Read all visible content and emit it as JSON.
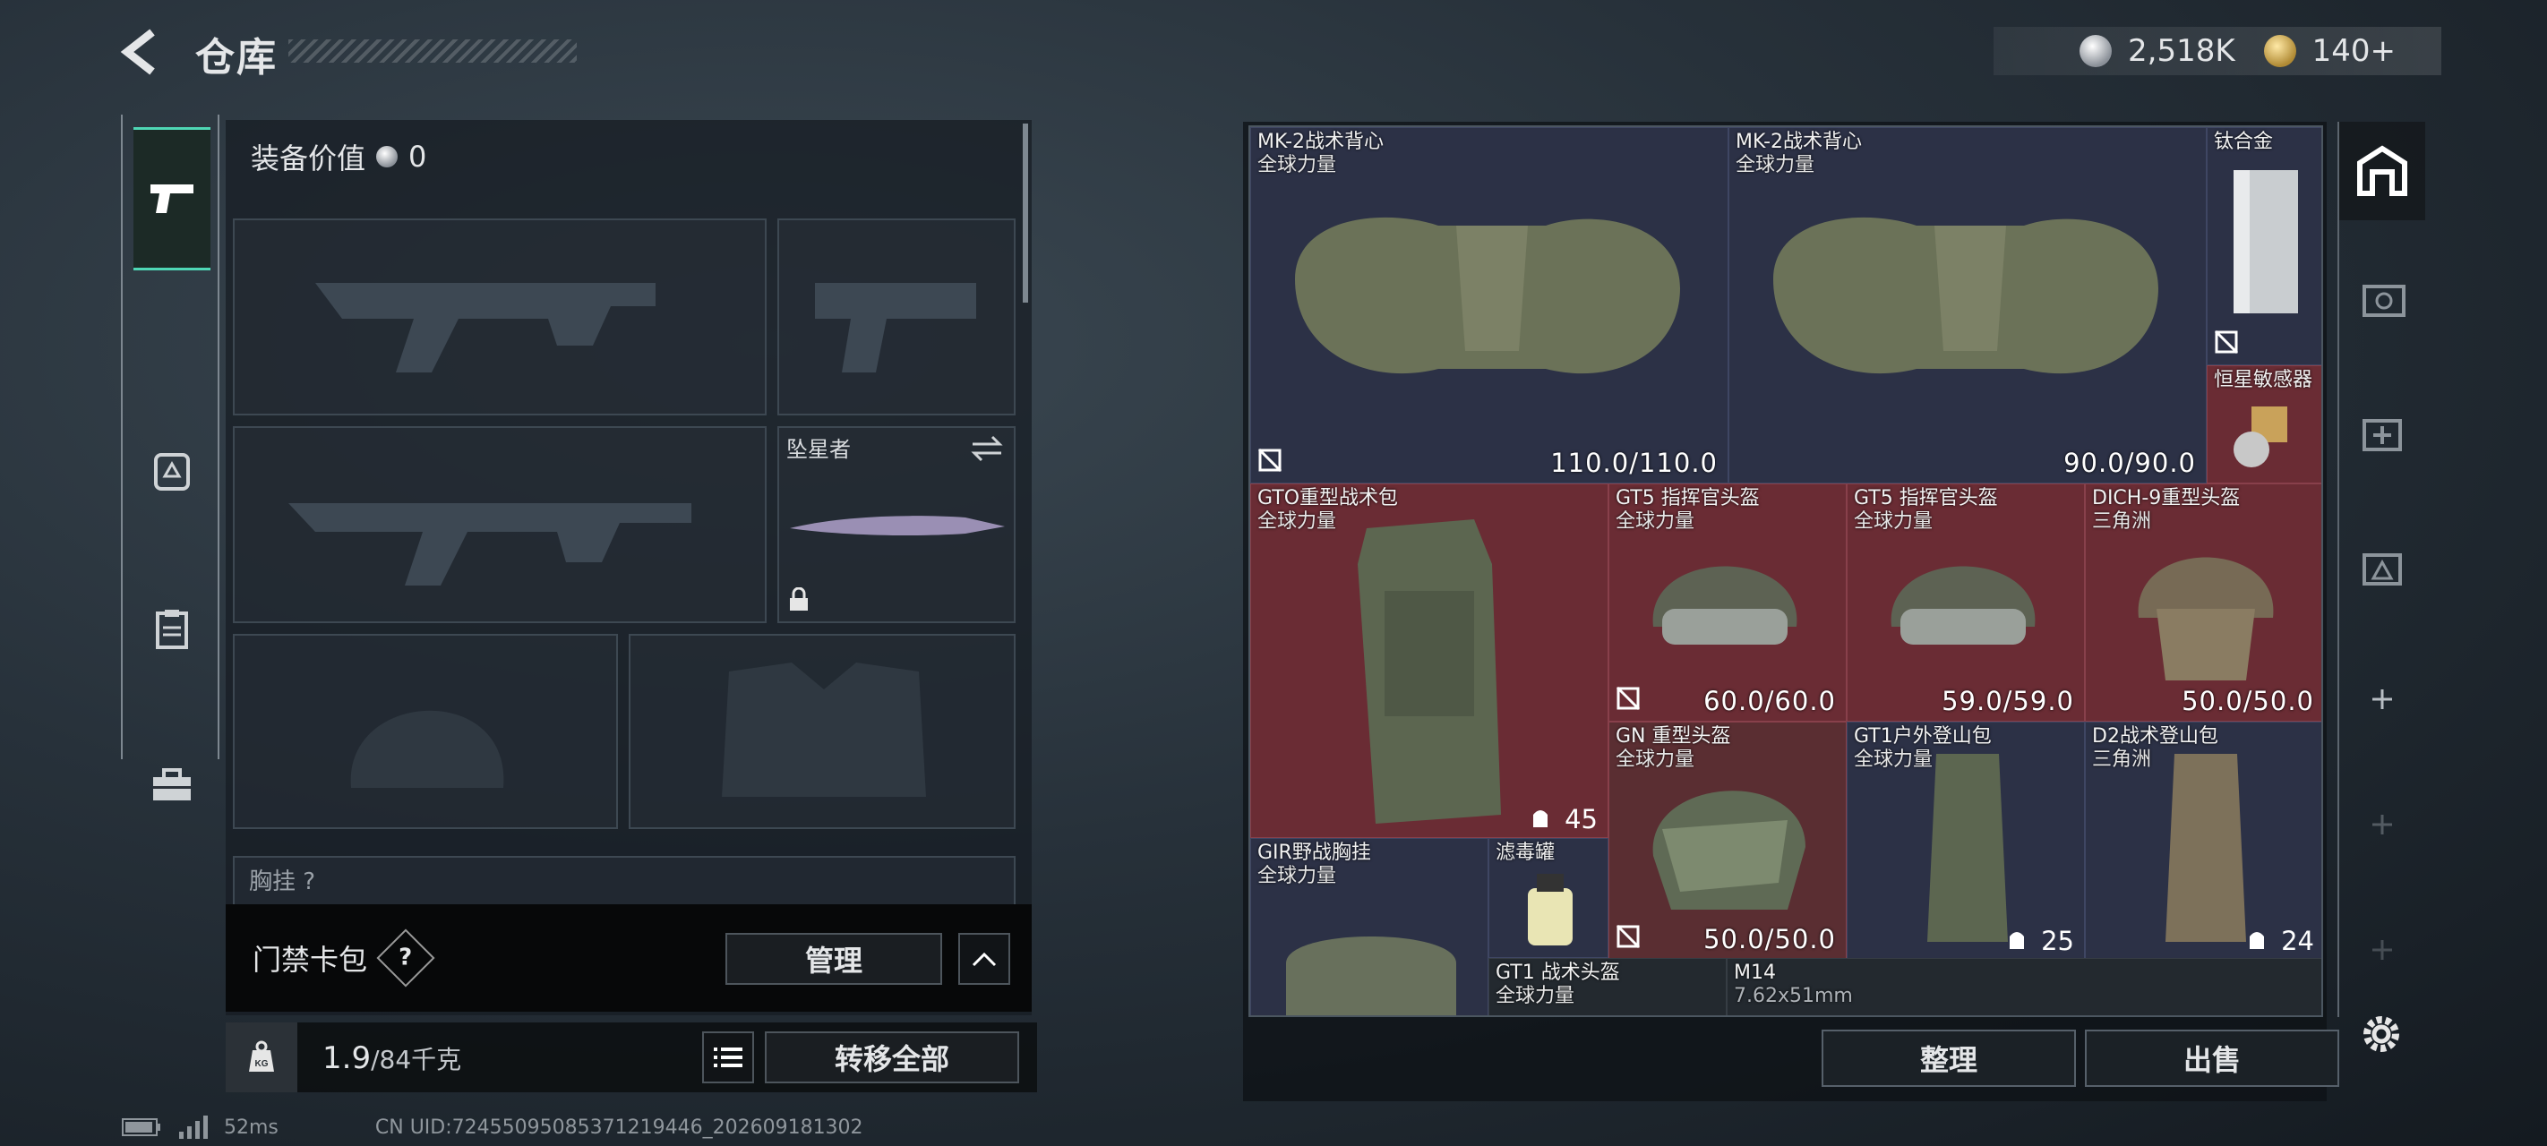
{
  "header": {
    "title": "仓库",
    "currency_silver": "2,518K",
    "currency_gold": "140+"
  },
  "loadout": {
    "equip_value_label": "装备价值",
    "equip_value": "0",
    "melee_name": "坠星者",
    "chest_label": "胸挂 ?"
  },
  "keycard": {
    "label": "门禁卡包",
    "help": "?",
    "manage": "管理"
  },
  "weight": {
    "current": "1.9",
    "max": "/84千克",
    "kg": "KG",
    "transfer_all": "转移全部"
  },
  "storage": {
    "items": [
      {
        "name": "MK-2战术背心",
        "sub": "全球力量",
        "dura": "110.0/110.0"
      },
      {
        "name": "MK-2战术背心",
        "sub": "全球力量",
        "dura": "90.0/90.0"
      },
      {
        "name": "钛合金",
        "sub": "",
        "dura": ""
      },
      {
        "name": "恒星敏感器",
        "sub": "",
        "dura": ""
      },
      {
        "name": "GTO重型战术包",
        "sub": "全球力量",
        "cap": "45"
      },
      {
        "name": "GT5 指挥官头盔",
        "sub": "全球力量",
        "dura": "60.0/60.0"
      },
      {
        "name": "GT5 指挥官头盔",
        "sub": "全球力量",
        "dura": "59.0/59.0"
      },
      {
        "name": "DICH-9重型头盔",
        "sub": "三角洲",
        "dura": "50.0/50.0"
      },
      {
        "name": "GN 重型头盔",
        "sub": "全球力量",
        "dura": "50.0/50.0"
      },
      {
        "name": "GT1户外登山包",
        "sub": "全球力量",
        "cap": "25"
      },
      {
        "name": "D2战术登山包",
        "sub": "三角洲",
        "cap": "24"
      },
      {
        "name": "GIR野战胸挂",
        "sub": "全球力量"
      },
      {
        "name": "滤毒罐",
        "sub": ""
      },
      {
        "name": "GT1 战术头盔",
        "sub": "全球力量"
      },
      {
        "name": "M14",
        "sub": "7.62x51mm"
      }
    ],
    "sort_label": "整理",
    "sell_label": "出售"
  },
  "status": {
    "ping": "52ms",
    "uid": "CN UID:7245509508537121944​6_202609181302"
  },
  "colors": {
    "accent": "#4fd7b5",
    "rare_red": "#6a2c34",
    "rare_blue": "#2c3146"
  }
}
